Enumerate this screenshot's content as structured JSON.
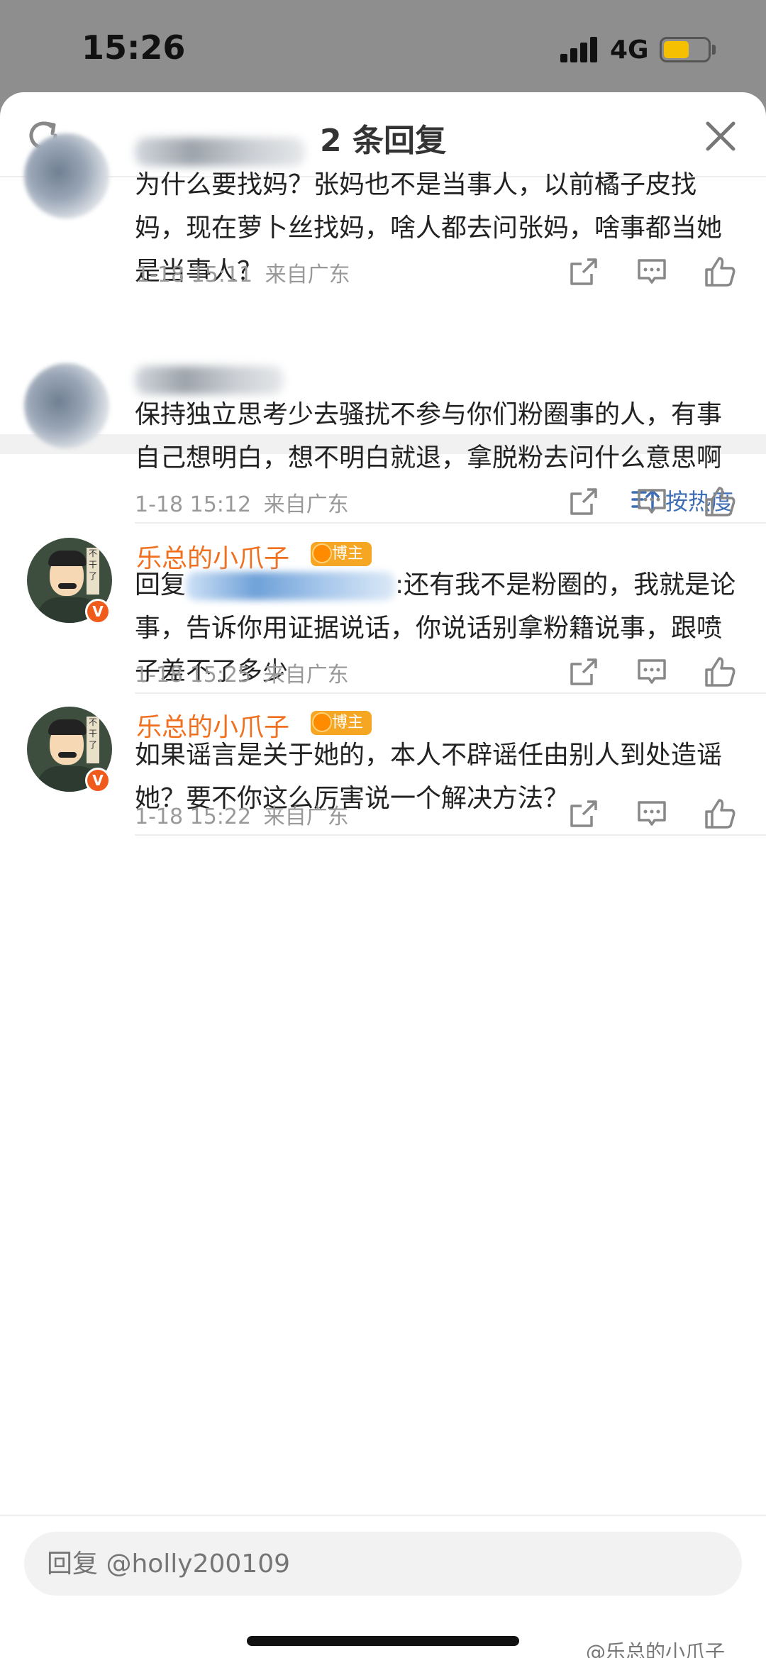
{
  "status_bar": {
    "time": "15:26",
    "network": "4G"
  },
  "header": {
    "title": "2 条回复"
  },
  "main_comment": {
    "text": "为什么要找妈？张妈也不是当事人，以前橘子皮找妈，现在萝卜丝找妈，啥人都去问张妈，啥事都当她是当事人？",
    "time": "1-18 15:11",
    "location": "来自广东"
  },
  "sort": {
    "label": "按热度"
  },
  "replies": [
    {
      "text": "保持独立思考少去骚扰不参与你们粉圈事的人，有事自己想明白，想不明白就退，拿脱粉去问什么意思啊",
      "time": "1-18 15:12",
      "location": "来自广东"
    },
    {
      "username": "乐总的小爪子",
      "badge": "博主",
      "reply_prefix": "回复",
      "text": ":还有我不是粉圈的，我就是论事，告诉你用证据说话，你说话别拿粉籍说事，跟喷子差不了多少",
      "time": "1-18 15:25",
      "location": "来自广东"
    },
    {
      "username": "乐总的小爪子",
      "badge": "博主",
      "text": "如果谣言是关于她的，本人不辟谣任由别人到处造谣她？要不你这么厉害说一个解决方法？",
      "time": "1-18 15:22",
      "location": "来自广东"
    }
  ],
  "input": {
    "placeholder": "回复 @holly200109"
  },
  "avatar_banner": "不干了",
  "verified_mark": "V",
  "watermark": "@乐总的小爪子",
  "colors": {
    "username": "#f0701f",
    "link": "#3f6eb4",
    "badge": "#f5a623"
  }
}
